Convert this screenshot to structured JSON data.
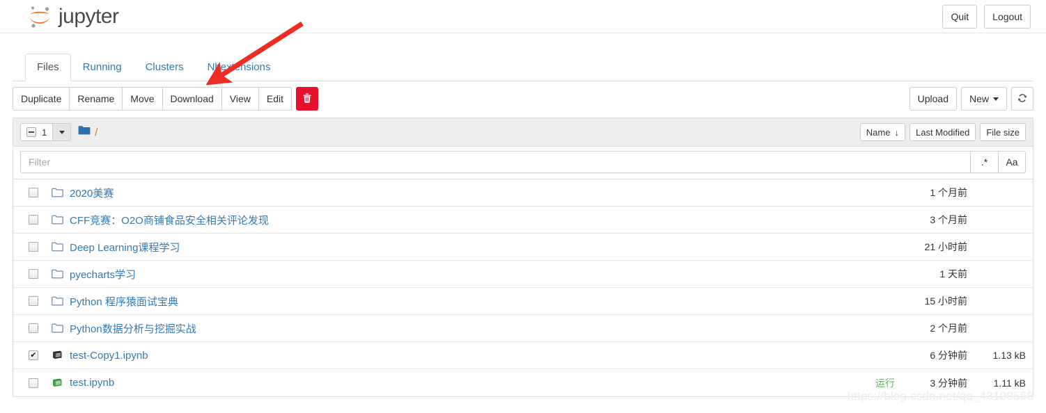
{
  "header": {
    "brand_text": "jupyter",
    "quit_label": "Quit",
    "logout_label": "Logout"
  },
  "tabs": [
    {
      "label": "Files",
      "active": true
    },
    {
      "label": "Running",
      "active": false
    },
    {
      "label": "Clusters",
      "active": false
    },
    {
      "label": "Nbextensions",
      "active": false
    }
  ],
  "toolbar": {
    "duplicate_label": "Duplicate",
    "rename_label": "Rename",
    "move_label": "Move",
    "download_label": "Download",
    "view_label": "View",
    "edit_label": "Edit",
    "delete_icon": "trash-icon",
    "upload_label": "Upload",
    "new_label": "New",
    "refresh_icon": "refresh-icon"
  },
  "list_header": {
    "selected_count": "1",
    "select_state": "indeterminate",
    "breadcrumb_root_icon": "folder-icon",
    "breadcrumb_separator": "/",
    "sort_name_label": "Name",
    "sort_name_arrow": "↓",
    "sort_modified_label": "Last Modified",
    "sort_size_label": "File size"
  },
  "filter": {
    "value": "",
    "placeholder": "Filter",
    "regex_label": ".*",
    "case_label": "Aa"
  },
  "files": [
    {
      "name": "2020美赛",
      "type": "folder",
      "icon": "folder-outline-icon",
      "checked": false,
      "running": "",
      "modified": "1 个月前",
      "size": ""
    },
    {
      "name": "CFF竞赛：O2O商铺食品安全相关评论发现",
      "type": "folder",
      "icon": "folder-outline-icon",
      "checked": false,
      "running": "",
      "modified": "3 个月前",
      "size": ""
    },
    {
      "name": "Deep Learning课程学习",
      "type": "folder",
      "icon": "folder-outline-icon",
      "checked": false,
      "running": "",
      "modified": "21 小时前",
      "size": ""
    },
    {
      "name": "pyecharts学习",
      "type": "folder",
      "icon": "folder-outline-icon",
      "checked": false,
      "running": "",
      "modified": "1 天前",
      "size": ""
    },
    {
      "name": "Python 程序猿面试宝典",
      "type": "folder",
      "icon": "folder-outline-icon",
      "checked": false,
      "running": "",
      "modified": "15 小时前",
      "size": ""
    },
    {
      "name": "Python数据分析与挖掘实战",
      "type": "folder",
      "icon": "folder-outline-icon",
      "checked": false,
      "running": "",
      "modified": "2 个月前",
      "size": ""
    },
    {
      "name": "test-Copy1.ipynb",
      "type": "notebook",
      "icon": "notebook-icon",
      "checked": true,
      "running": "",
      "modified": "6 分钟前",
      "size": "1.13 kB"
    },
    {
      "name": "test.ipynb",
      "type": "notebook-running",
      "icon": "notebook-running-icon",
      "checked": false,
      "running": "运行",
      "modified": "3 分钟前",
      "size": "1.11 kB"
    }
  ],
  "annotation": {
    "type": "arrow",
    "color": "#ef2b22",
    "points_to": "Download"
  },
  "watermark": {
    "text": "https://blog.csdn.net/qq_43198568"
  },
  "colors": {
    "link": "#337ab7",
    "brand_orange": "#f37726",
    "danger": "#e8112d",
    "running_green": "#5cb85c",
    "folder_blue": "#337ab7"
  }
}
